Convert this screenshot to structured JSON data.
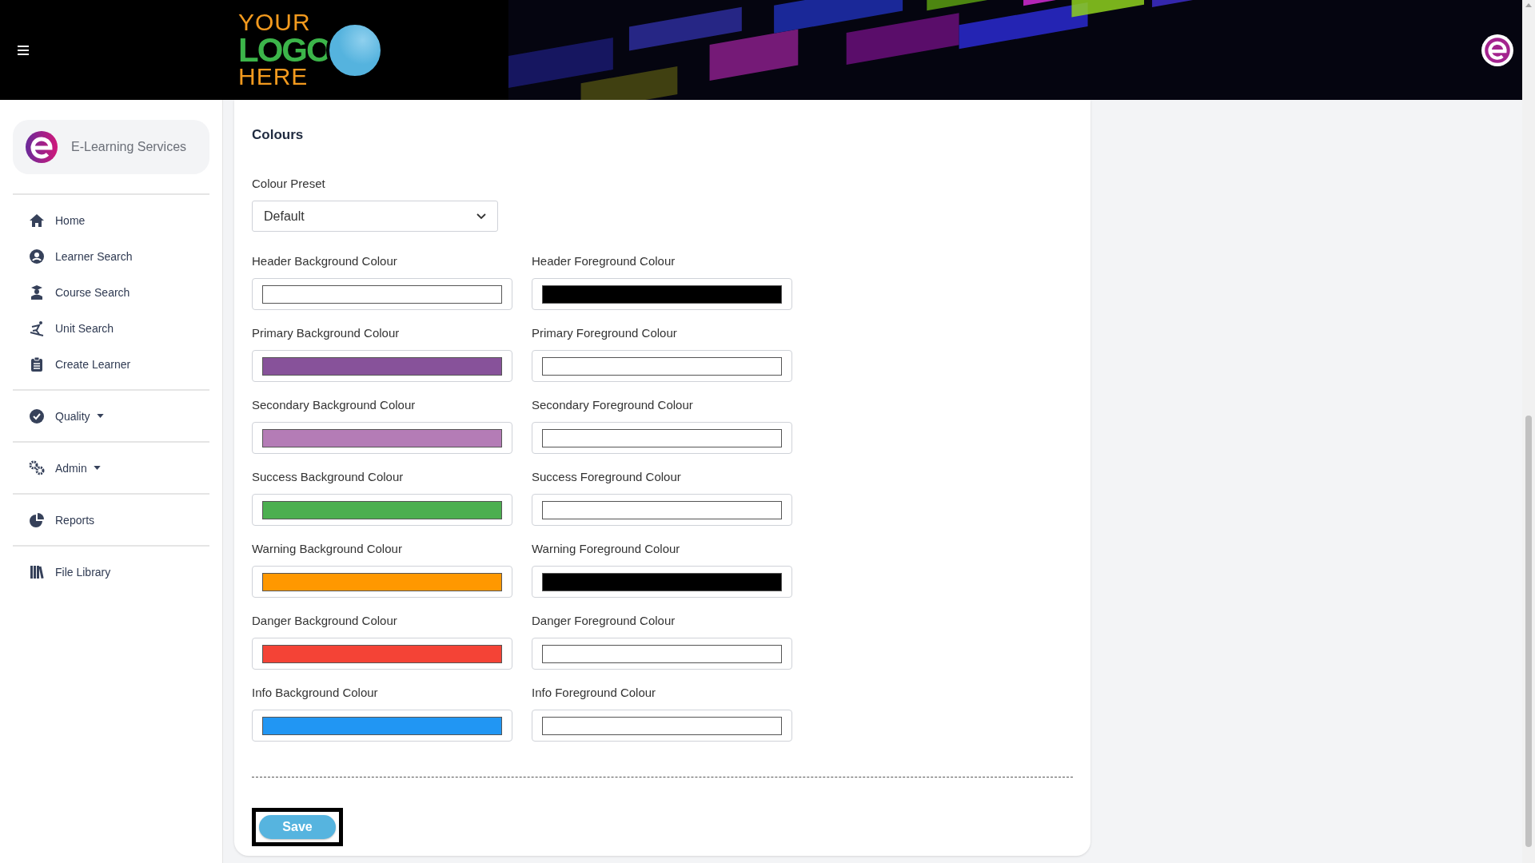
{
  "header": {
    "logo": [
      "YOUR",
      "LOGO",
      "HERE"
    ]
  },
  "sidebar": {
    "brand": "E-Learning Services",
    "groups": [
      {
        "items": [
          {
            "label": "Home",
            "dropdown": false
          },
          {
            "label": "Learner Search",
            "dropdown": false
          },
          {
            "label": "Course Search",
            "dropdown": false
          },
          {
            "label": "Unit Search",
            "dropdown": false
          },
          {
            "label": "Create Learner",
            "dropdown": false
          }
        ]
      },
      {
        "items": [
          {
            "label": "Quality",
            "dropdown": true
          }
        ]
      },
      {
        "items": [
          {
            "label": "Admin",
            "dropdown": true
          }
        ]
      },
      {
        "items": [
          {
            "label": "Reports",
            "dropdown": false
          }
        ]
      },
      {
        "items": [
          {
            "label": "File Library",
            "dropdown": false
          }
        ]
      }
    ]
  },
  "form": {
    "title": "Colours",
    "preset": {
      "label": "Colour Preset",
      "value": "Default"
    },
    "fields": [
      {
        "label": "Header Background Colour",
        "color": "#ffffff"
      },
      {
        "label": "Header Foreground Colour",
        "color": "#000000"
      },
      {
        "label": "Primary Background Colour",
        "color": "#87529a"
      },
      {
        "label": "Primary Foreground Colour",
        "color": "#ffffff"
      },
      {
        "label": "Secondary Background Colour",
        "color": "#b47cb6"
      },
      {
        "label": "Secondary Foreground Colour",
        "color": "#ffffff"
      },
      {
        "label": "Success Background Colour",
        "color": "#4caf50"
      },
      {
        "label": "Success Foreground Colour",
        "color": "#ffffff"
      },
      {
        "label": "Warning Background Colour",
        "color": "#ff9800"
      },
      {
        "label": "Warning Foreground Colour",
        "color": "#000000"
      },
      {
        "label": "Danger Background Colour",
        "color": "#f44336"
      },
      {
        "label": "Danger Foreground Colour",
        "color": "#ffffff"
      },
      {
        "label": "Info Background Colour",
        "color": "#2196f3"
      },
      {
        "label": "Info Foreground Colour",
        "color": "#ffffff"
      }
    ],
    "save": "Save"
  }
}
